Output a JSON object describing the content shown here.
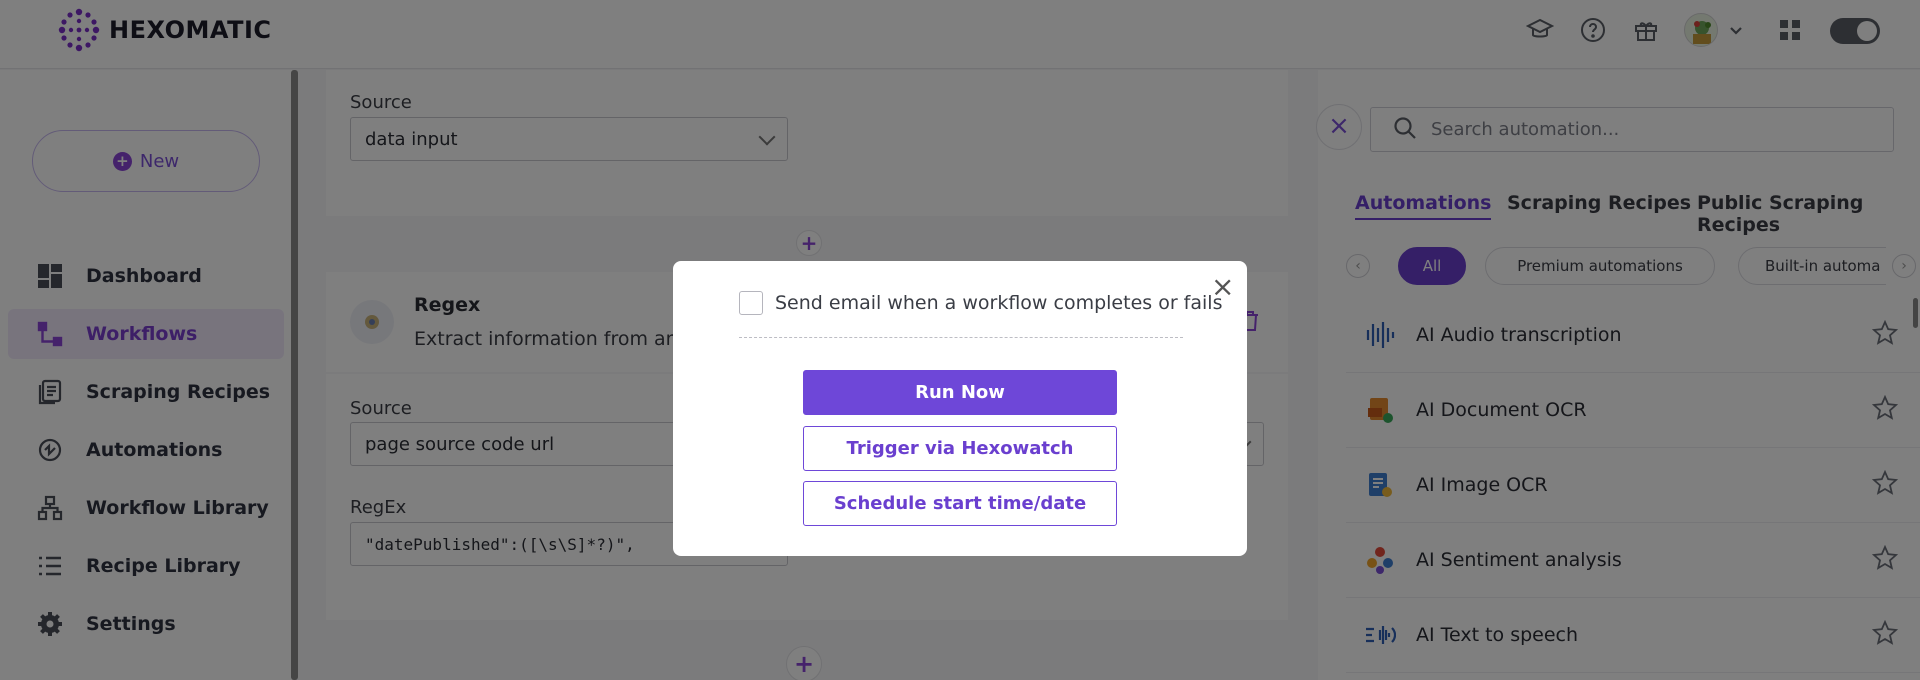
{
  "header": {
    "logo_text": "HEXOMATIC",
    "icons": [
      "graduation-cap-icon",
      "help-circle-icon",
      "gift-icon",
      "avatar",
      "chevron-down-icon",
      "apps-grid-icon",
      "theme-toggle"
    ]
  },
  "sidebar": {
    "new_label": "New",
    "items": [
      {
        "label": "Dashboard",
        "icon": "dashboard-icon"
      },
      {
        "label": "Workflows",
        "icon": "workflows-icon",
        "active": true
      },
      {
        "label": "Scraping Recipes",
        "icon": "scraping-recipes-icon"
      },
      {
        "label": "Automations",
        "icon": "automations-icon"
      },
      {
        "label": "Workflow Library",
        "icon": "workflow-library-icon"
      },
      {
        "label": "Recipe Library",
        "icon": "recipe-library-icon"
      },
      {
        "label": "Settings",
        "icon": "gear-icon"
      }
    ]
  },
  "main": {
    "step1": {
      "source_label": "Source",
      "source_value": "data input"
    },
    "step2": {
      "title": "Regex",
      "description": "Extract information from any t",
      "source_label": "Source",
      "source_value": "page source code url",
      "regex_label": "RegEx",
      "regex_value": "\"datePublished\":([\\s\\S]*?)\","
    },
    "add_symbol": "+"
  },
  "right_panel": {
    "close_symbol": "×",
    "search_placeholder": "Search automation...",
    "tabs": [
      "Automations",
      "Scraping Recipes",
      "Public Scraping Recipes"
    ],
    "chips": [
      "All",
      "Premium automations",
      "Built-in automa"
    ],
    "automations": [
      {
        "label": "AI Audio transcription",
        "icon": "audio-waveform-icon"
      },
      {
        "label": "AI Document OCR",
        "icon": "document-ocr-icon"
      },
      {
        "label": "AI Image OCR",
        "icon": "image-ocr-icon"
      },
      {
        "label": "AI Sentiment analysis",
        "icon": "sentiment-icon"
      },
      {
        "label": "AI Text to speech",
        "icon": "text-to-speech-icon"
      }
    ]
  },
  "modal": {
    "close_symbol": "×",
    "checkbox_label": "Send email when a workflow completes or fails",
    "run_now": "Run Now",
    "trigger": "Trigger via Hexowatch",
    "schedule": "Schedule start time/date"
  },
  "colors": {
    "accent": "#6e47d8",
    "overlay": "rgba(0,0,0,0.5)"
  }
}
